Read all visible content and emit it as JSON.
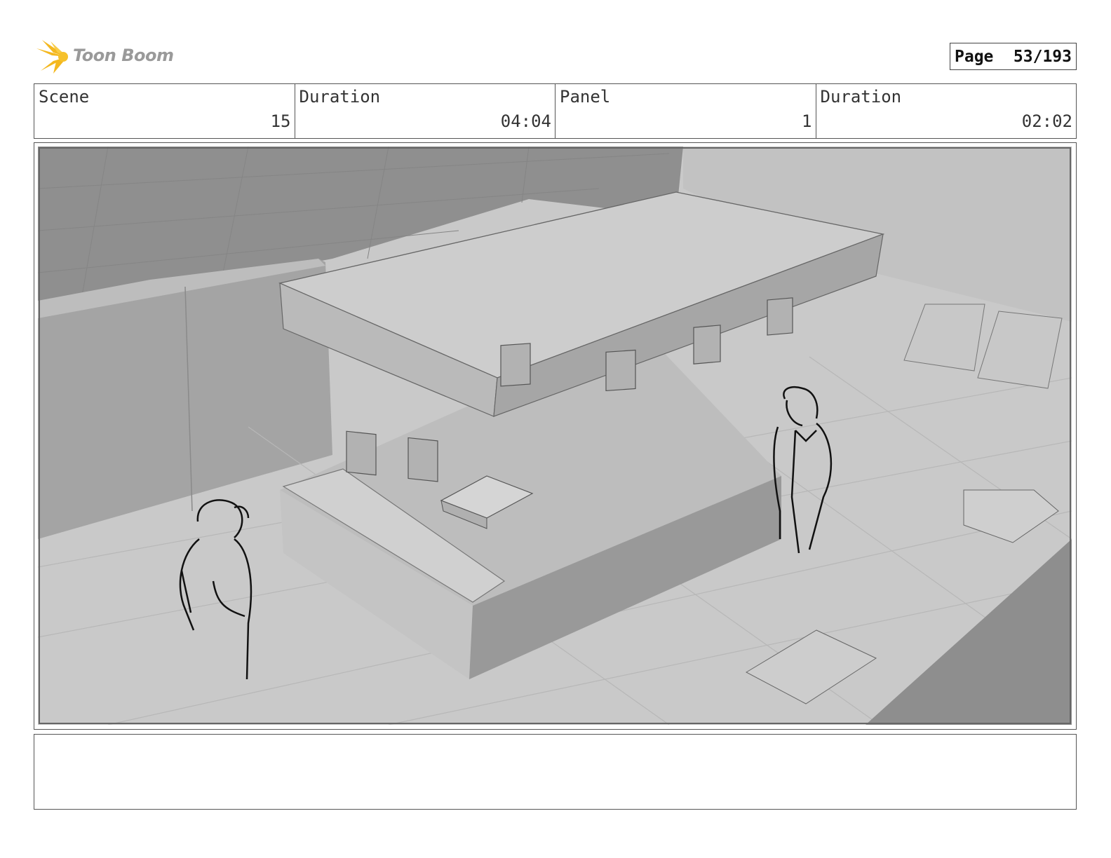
{
  "brand": {
    "name": "Toon Boom",
    "logo_icon": "starburst-logo-icon",
    "accent": "#f4b81f"
  },
  "page": {
    "label": "Page",
    "number": "53/193"
  },
  "header": {
    "scene_label": "Scene",
    "scene_value": "15",
    "scene_duration_label": "Duration",
    "scene_duration_value": "04:04",
    "panel_label": "Panel",
    "panel_value": "1",
    "panel_duration_label": "Duration",
    "panel_duration_value": "02:02"
  },
  "panel": {
    "image": "storyboard-sketch-icon"
  },
  "notes": {
    "text": ""
  }
}
